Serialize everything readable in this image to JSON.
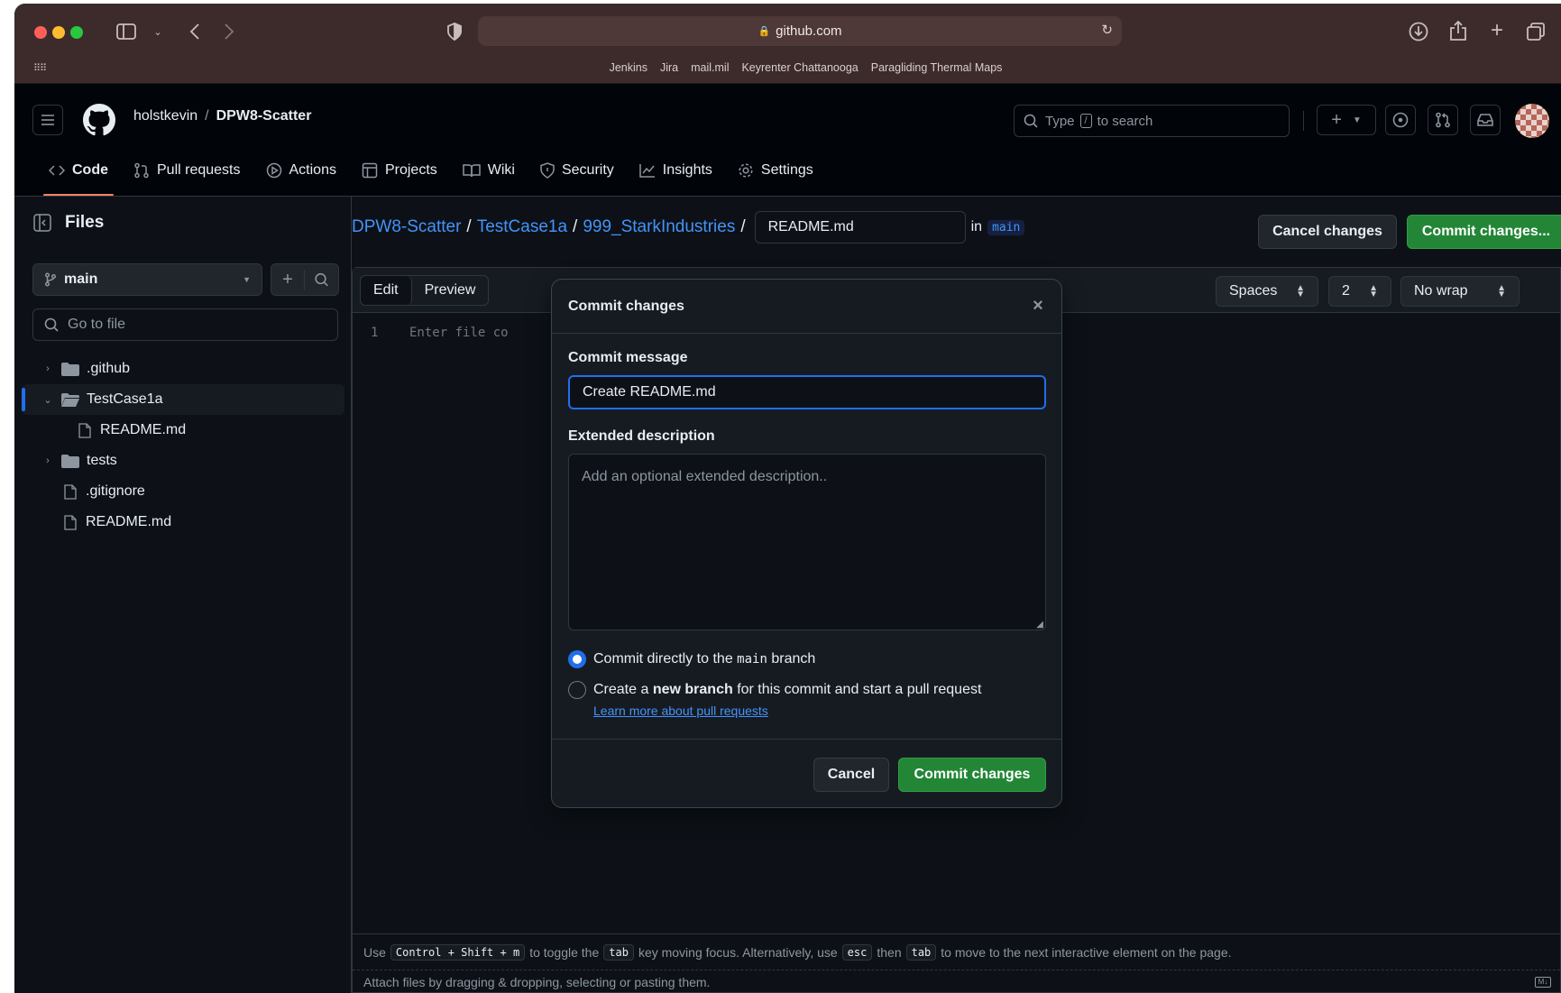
{
  "browser": {
    "url": "github.com",
    "favorites": [
      "Jenkins",
      "Jira",
      "mail.mil",
      "Keyrenter Chattanooga",
      "Paragliding Thermal Maps"
    ]
  },
  "header": {
    "owner": "holstkevin",
    "separator": "/",
    "repo": "DPW8-Scatter",
    "search_prefix": "Type",
    "search_key": "/",
    "search_suffix": "to search"
  },
  "tabs": [
    {
      "label": "Code",
      "icon": "code-icon"
    },
    {
      "label": "Pull requests",
      "icon": "pull-request-icon"
    },
    {
      "label": "Actions",
      "icon": "play-icon"
    },
    {
      "label": "Projects",
      "icon": "table-icon"
    },
    {
      "label": "Wiki",
      "icon": "book-icon"
    },
    {
      "label": "Security",
      "icon": "shield-icon"
    },
    {
      "label": "Insights",
      "icon": "graph-icon"
    },
    {
      "label": "Settings",
      "icon": "gear-icon"
    }
  ],
  "sidebar": {
    "title": "Files",
    "branch": "main",
    "goto_placeholder": "Go to file",
    "tree": [
      {
        "name": ".github",
        "type": "folder"
      },
      {
        "name": "TestCase1a",
        "type": "folder-open"
      },
      {
        "name": "README.md",
        "type": "file"
      },
      {
        "name": "tests",
        "type": "folder"
      },
      {
        "name": ".gitignore",
        "type": "file"
      },
      {
        "name": "README.md",
        "type": "file"
      }
    ]
  },
  "editor": {
    "path": [
      "DPW8-Scatter",
      "TestCase1a",
      "999_StarkIndustries"
    ],
    "filename": "README.md",
    "in_label": "in",
    "branch": "main",
    "cancel_label": "Cancel changes",
    "commit_label": "Commit changes...",
    "tab_edit": "Edit",
    "tab_preview": "Preview",
    "indent_mode": "Spaces",
    "indent_size": "2",
    "wrap_mode": "No wrap",
    "line_number": "1",
    "placeholder": "Enter file co",
    "footer_use": "Use",
    "footer_keys": "Control + Shift + m",
    "footer_mid1": "to toggle the",
    "footer_tab": "tab",
    "footer_mid2": "key moving focus. Alternatively, use",
    "footer_esc": "esc",
    "footer_then": "then",
    "footer_end": "to move to the next interactive element on the page.",
    "attach_text": "Attach files by dragging & dropping, selecting or pasting them."
  },
  "dialog": {
    "title": "Commit changes",
    "message_label": "Commit message",
    "message_value": "Create README.md",
    "desc_label": "Extended description",
    "desc_placeholder": "Add an optional extended description..",
    "option1_pre": "Commit directly to the",
    "option1_branch": "main",
    "option1_post": "branch",
    "option2_pre": "Create a",
    "option2_bold": "new branch",
    "option2_post": "for this commit and start a pull request",
    "learn_more": "Learn more about pull requests",
    "cancel": "Cancel",
    "commit": "Commit changes"
  }
}
